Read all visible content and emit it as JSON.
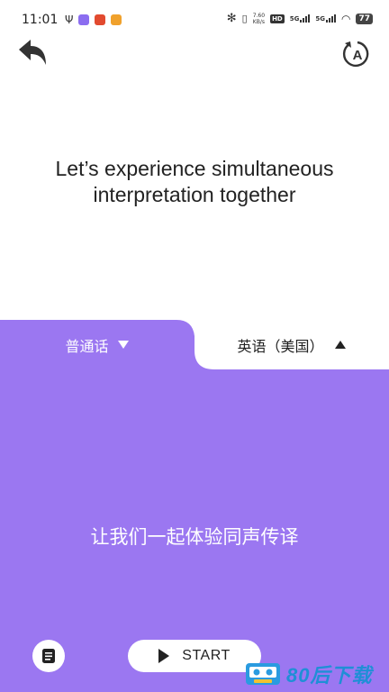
{
  "status_bar": {
    "time": "11:01",
    "speed_value": "7.60",
    "speed_unit": "KB/s",
    "hd_label": "HD",
    "network_1": "5G",
    "network_2": "5G",
    "battery": "77"
  },
  "intro": {
    "line1": "Let’s experience simultaneous",
    "line2": "interpretation together"
  },
  "languages": {
    "source": "普通话",
    "target": "英语（美国）"
  },
  "prompt_text": "让我们一起体验同声传译",
  "controls": {
    "start_label": "START"
  },
  "watermark": {
    "text": "80后下载"
  },
  "colors": {
    "accent": "#9b77f1",
    "background": "#ffffff",
    "text": "#222222"
  }
}
